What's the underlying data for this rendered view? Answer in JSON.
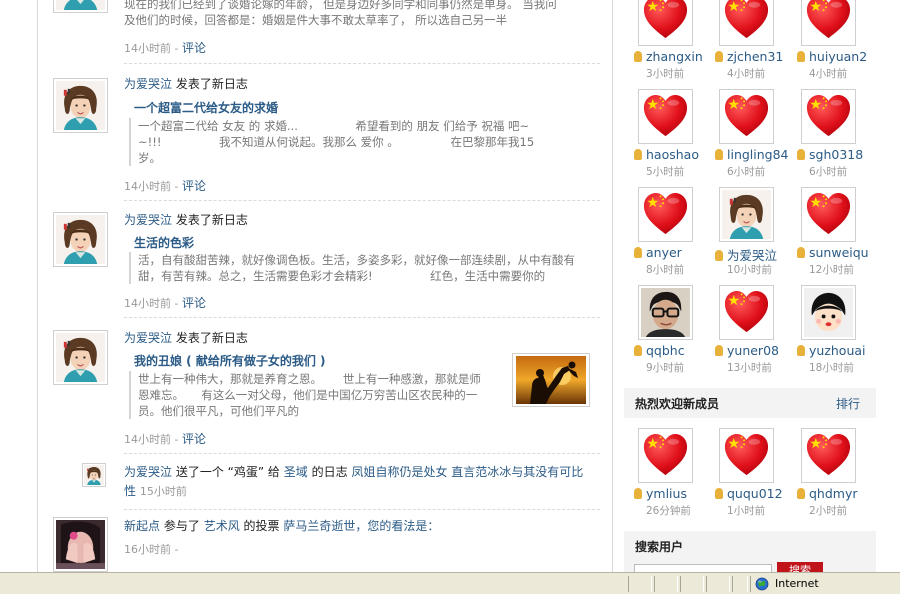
{
  "feed": {
    "item0": {
      "text_line1": "现在的我们已经到了谈婚论嫁的年龄， 但是身边好多同学和同事仍然是单身。 当我问",
      "text_line2": "及他们的时候，回答都是：婚姻是件大事不敢太草率了， 所以选自己另一半",
      "time": "14小时前",
      "sep": " - ",
      "comment": "评论"
    },
    "item1": {
      "user": "为爱哭泣",
      "action": "发表了新日志",
      "title": "一个超富二代给女友的求婚",
      "line1": "一个超富二代给 女友 的 求婚...　　　　　希望看到的 朋友 们给予 祝福 吧~",
      "line2": "~!!!　　　　　我不知道从何说起。我那么 爱你 。　　　　　在巴黎那年我15",
      "line3": "岁。",
      "time": "14小时前",
      "sep": " - ",
      "comment": "评论"
    },
    "item2": {
      "user": "为爱哭泣",
      "action": "发表了新日志",
      "title": "生活的色彩",
      "line1": "活，自有酸甜苦辣，就好像调色板。生活，多姿多彩，就好像一部连续剧，从中有酸有",
      "line2": "甜，有苦有辣。总之，生活需要色彩才会精彩!　　　　　红色，生活中需要你的",
      "time": "14小时前",
      "sep": " - ",
      "comment": "评论"
    },
    "item3": {
      "user": "为爱哭泣",
      "action": "发表了新日志",
      "title": "我的丑娘 ( 献给所有做子女的我们 )",
      "line1": "世上有一种伟大，那就是养育之恩。　　 世上有一种感激，那就是师",
      "line2": "恩难忘。　　有这么一对父母，他们是中国亿万穷苦山区农民种的一",
      "line3": "员。他们很平凡，可他们平凡的",
      "time": "14小时前",
      "sep": " - ",
      "comment": "评论"
    },
    "item4": {
      "user": "为爱哭泣",
      "w1": "送了一个 “鸡蛋” 给",
      "target_user": "圣域",
      "w2": "的日志",
      "post_title": "凤姐自称仍是处女 直言范冰冰与其没有可比",
      "post_title_2": "性",
      "time": "15小时前"
    },
    "item5": {
      "user": "新起点",
      "w1": "参与了",
      "target_user": "艺术风",
      "w2": "的投票",
      "poll_title": "萨马兰奇逝世，您的看法是：",
      "time": "16小时前",
      "sep": " -"
    }
  },
  "members_top": [
    {
      "name": "zhangxin",
      "time": "3小时前",
      "icon": "heart-flag"
    },
    {
      "name": "zjchen31",
      "time": "4小时前",
      "icon": "heart-flag"
    },
    {
      "name": "huiyuan2",
      "time": "4小时前",
      "icon": "heart-flag"
    },
    {
      "name": "haoshao",
      "time": "5小时前",
      "icon": "heart-flag"
    },
    {
      "name": "lingling84",
      "time": "6小时前",
      "icon": "heart-flag"
    },
    {
      "name": "sgh0318",
      "time": "6小时前",
      "icon": "heart-flag"
    },
    {
      "name": "anyer",
      "time": "8小时前",
      "icon": "heart-flag"
    },
    {
      "name": "为爱哭泣",
      "time": "10小时前",
      "icon": "woman-photo"
    },
    {
      "name": "sunweiqu",
      "time": "12小时前",
      "icon": "heart-flag"
    },
    {
      "name": "qqbhc",
      "time": "9小时前",
      "icon": "man-glasses-photo"
    },
    {
      "name": "yuner08",
      "time": "13小时前",
      "icon": "heart-flag"
    },
    {
      "name": "yuzhouai",
      "time": "18小时前",
      "icon": "cartoon-face"
    }
  ],
  "new_members": {
    "title": "热烈欢迎新成员",
    "rank_link": "排行",
    "items": [
      {
        "name": "ymlius",
        "time": "26分钟前",
        "icon": "heart-flag"
      },
      {
        "name": "ququ012",
        "time": "1小时前",
        "icon": "heart-flag"
      },
      {
        "name": "qhdmyr",
        "time": "2小时前",
        "icon": "heart-flag"
      }
    ]
  },
  "search": {
    "title": "搜索用户",
    "button_label": "搜索"
  },
  "statusbar": {
    "zone_label": "Internet",
    "zone_icon": "globe-icon"
  },
  "colors": {
    "link": "#2b5b86",
    "heart_red": "#e0101a",
    "star_yellow": "#ffe000",
    "search_button": "#c0131a",
    "statusbar_bg": "#ece9d8"
  }
}
